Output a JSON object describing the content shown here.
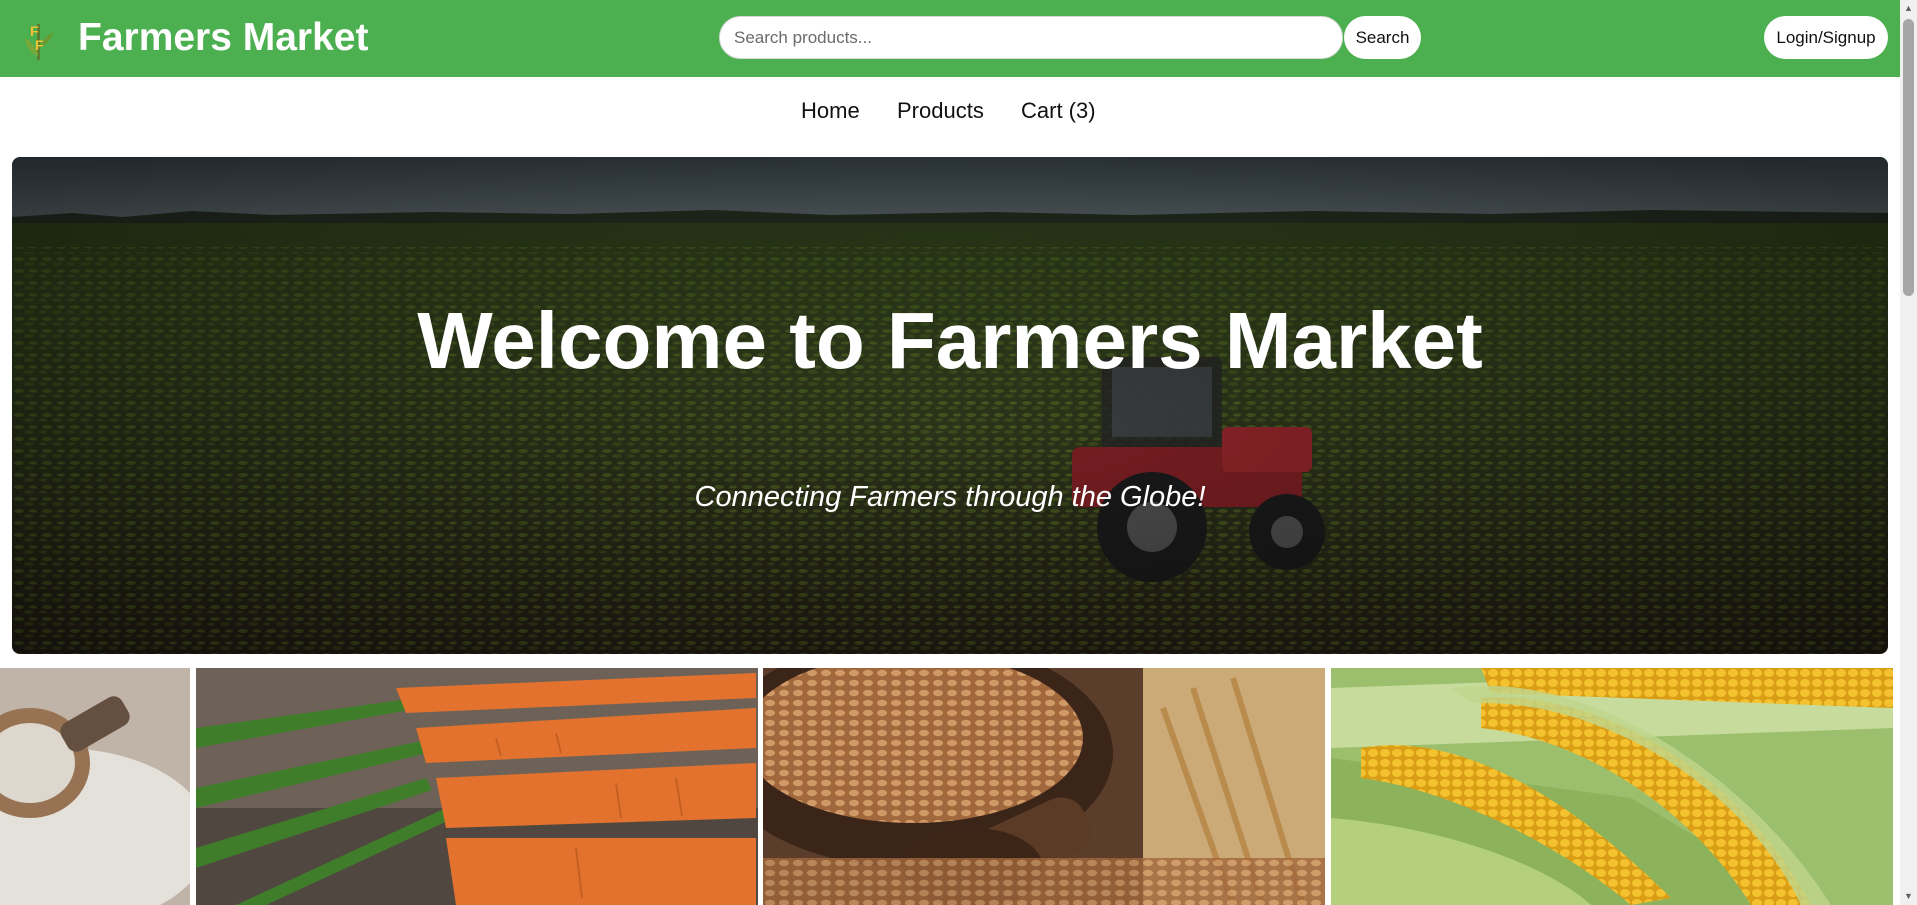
{
  "header": {
    "brand": "Farmers Market",
    "logo_icon": "corn-stalk-logo-icon",
    "search_placeholder": "Search products...",
    "search_button": "Search",
    "login_button": "Login/Signup",
    "accent_color": "#4caf50"
  },
  "nav": {
    "items": [
      {
        "label": "Home"
      },
      {
        "label": "Products"
      },
      {
        "label": "Cart (3)"
      }
    ]
  },
  "hero": {
    "title": "Welcome to Farmers Market",
    "subtitle": "Connecting Farmers through the Globe!",
    "image": "tractor-in-green-field-photo"
  },
  "products": {
    "images": [
      "flour-with-scoop-photo",
      "carrots-photo",
      "wheat-grains-bowl-photo",
      "corn-cobs-photo"
    ]
  }
}
